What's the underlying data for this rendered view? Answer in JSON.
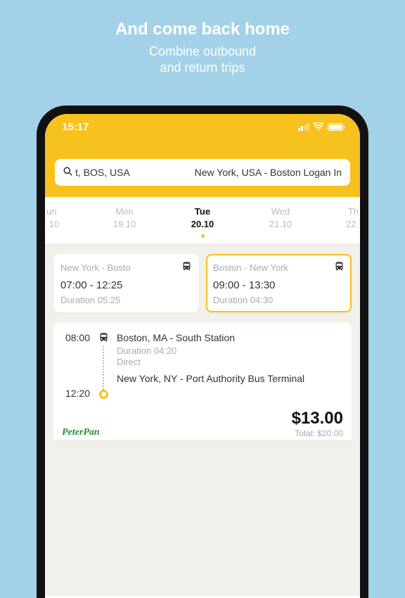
{
  "promo": {
    "title": "And come back home",
    "subtitle_line1": "Combine outbound",
    "subtitle_line2": "and return trips"
  },
  "status": {
    "time": "15:17"
  },
  "search": {
    "origin": "t, BOS, USA",
    "destination": "New York, USA - Boston Logan In"
  },
  "dates": [
    {
      "day": "un",
      "date": ".10"
    },
    {
      "day": "Mon",
      "date": "19.10"
    },
    {
      "day": "Tue",
      "date": "20.10"
    },
    {
      "day": "Wed",
      "date": "21.10"
    },
    {
      "day": "Th",
      "date": "22."
    }
  ],
  "trip_cards": [
    {
      "route": "New York - Bosto",
      "time": "07:00 - 12:25",
      "duration": "Duration 05:25"
    },
    {
      "route": "Boston - New York",
      "time": "09:00 - 13:30",
      "duration": "Duration 04:30"
    }
  ],
  "result": {
    "depart_time": "08:00",
    "arrive_time": "12:20",
    "depart_station": "Boston, MA - South Station",
    "duration": "Duration 04:20",
    "direct": "Direct",
    "arrive_station": "New York, NY - Port Authority Bus Terminal",
    "carrier": "PeterPan",
    "price": "$13.00",
    "total": "Total: $20.00"
  }
}
